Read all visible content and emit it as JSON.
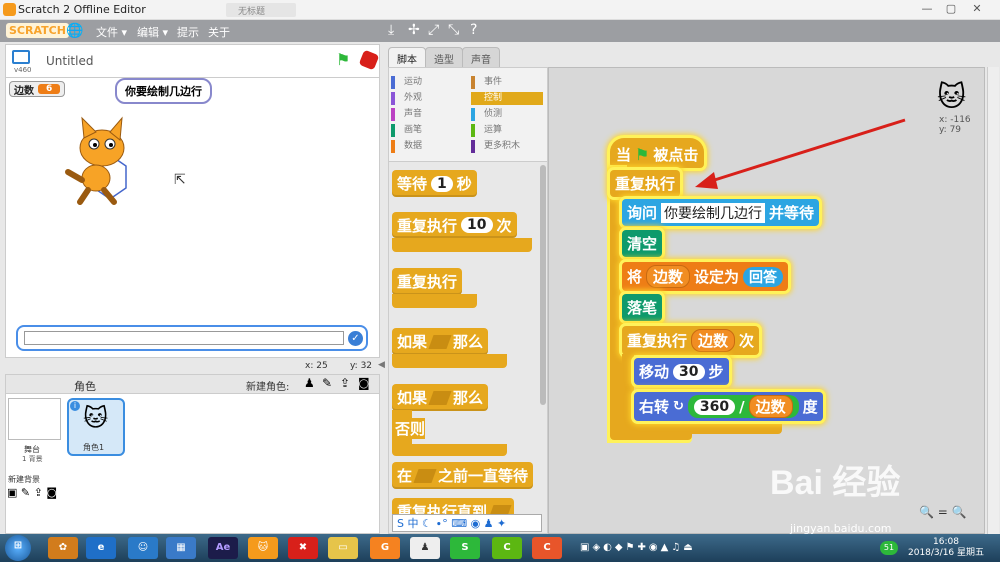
{
  "window": {
    "title": "Scratch 2 Offline Editor",
    "second_tab": "无标题",
    "buttons": [
      "—",
      "▢",
      "✕"
    ]
  },
  "menu": {
    "logo": "SCRATCH",
    "items": [
      "文件 ▾",
      "编辑 ▾",
      "提示",
      "关于"
    ],
    "tools": [
      "⤓",
      "✢",
      "⤢",
      "⤡",
      "?"
    ]
  },
  "stage": {
    "version": "v460",
    "project_title": "Untitled",
    "variable_monitor": {
      "name": "边数",
      "value": "6"
    },
    "speech_bubble": "你要绘制几边行",
    "ask_input": "",
    "coords": {
      "x": "x: 25",
      "y": "y: 32"
    }
  },
  "sprites": {
    "header": "角色",
    "new_sprite_label": "新建角色:",
    "stage_label": "舞台",
    "stage_sub": "1 背景",
    "new_backdrop": "新建背景",
    "sprite_name": "角色1"
  },
  "tabs": [
    "脚本",
    "造型",
    "声音"
  ],
  "categories": [
    {
      "name": "运动",
      "color": "#4a6cd4"
    },
    {
      "name": "外观",
      "color": "#8a55d7"
    },
    {
      "name": "声音",
      "color": "#bb42c3"
    },
    {
      "name": "画笔",
      "color": "#0e9a6c"
    },
    {
      "name": "数据",
      "color": "#ee7d16"
    },
    {
      "name": "事件",
      "color": "#c88330"
    },
    {
      "name": "控制",
      "color": "#e1a91a"
    },
    {
      "name": "侦测",
      "color": "#2ca5e2"
    },
    {
      "name": "运算",
      "color": "#5cb712"
    },
    {
      "name": "更多积木",
      "color": "#632d99"
    }
  ],
  "palette": {
    "wait": {
      "text": "等待",
      "value": "1",
      "unit": "秒"
    },
    "repeat_n": {
      "text": "重复执行",
      "value": "10",
      "unit": "次"
    },
    "forever": "重复执行",
    "if_then": {
      "a": "如果",
      "b": "那么"
    },
    "if_else": {
      "a": "如果",
      "b": "那么",
      "c": "否则"
    },
    "wait_until": {
      "a": "在",
      "b": "之前一直等待"
    },
    "repeat_until": "重复执行直到"
  },
  "script": {
    "hat": {
      "a": "当",
      "b": "被点击"
    },
    "forever": "重复执行",
    "ask": {
      "a": "询问",
      "input": "你要绘制几边行",
      "b": "并等待"
    },
    "clear": "清空",
    "set": {
      "a": "将",
      "var": "边数",
      "b": "设定为",
      "val": "回答"
    },
    "pendown": "落笔",
    "repeat": {
      "a": "重复执行",
      "var": "边数",
      "b": "次"
    },
    "move": {
      "a": "移动",
      "val": "30",
      "b": "步"
    },
    "turn": {
      "a": "右转",
      "num": "360",
      "div": "/",
      "var": "边数",
      "b": "度"
    }
  },
  "sprite_info": {
    "x": "x: -116",
    "y": "y: 79"
  },
  "watermark": {
    "text": "Bai 经验",
    "url": "jingyan.baidu.com"
  },
  "taskbar": {
    "time": "16:08",
    "date": "2018/3/16 星期五",
    "badge": "51"
  }
}
